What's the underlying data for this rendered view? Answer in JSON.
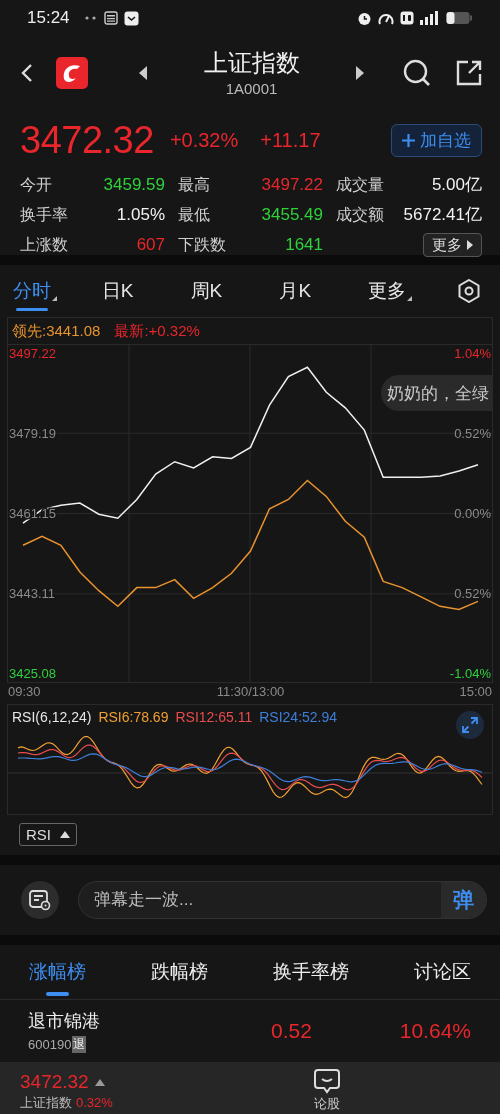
{
  "status_bar": {
    "time": "15:24"
  },
  "header": {
    "title": "上证指数",
    "code": "1A0001"
  },
  "quote": {
    "price": "3472.32",
    "change_pct": "+0.32%",
    "change": "+11.17",
    "watch_button": "加自选",
    "more_button": "更多",
    "stats": [
      {
        "label": "今开",
        "value": "3459.59",
        "color": "#2fd13a"
      },
      {
        "label": "最高",
        "value": "3497.22",
        "color": "#e8262b"
      },
      {
        "label": "成交量",
        "value": "5.00亿",
        "color": "#f2f2f2"
      },
      {
        "label": "换手率",
        "value": "1.05%",
        "color": "#f2f2f2"
      },
      {
        "label": "最低",
        "value": "3455.49",
        "color": "#2fd13a"
      },
      {
        "label": "成交额",
        "value": "5672.41亿",
        "color": "#f2f2f2"
      },
      {
        "label": "上涨数",
        "value": "607",
        "color": "#e8262b"
      },
      {
        "label": "下跌数",
        "value": "1641",
        "color": "#2fd13a"
      }
    ]
  },
  "period_tabs": [
    {
      "label": "分时",
      "selected": true,
      "has_menu": true
    },
    {
      "label": "日K",
      "selected": false,
      "has_menu": false
    },
    {
      "label": "周K",
      "selected": false,
      "has_menu": false
    },
    {
      "label": "月K",
      "selected": false,
      "has_menu": false
    },
    {
      "label": "更多",
      "selected": false,
      "has_menu": true
    }
  ],
  "intraday": {
    "legend": [
      {
        "text": "领先:3441.08",
        "color": "#e8932d"
      },
      {
        "text": "最新:+0.32%",
        "color": "#e8262b"
      }
    ],
    "right_axis": [
      {
        "text": "1.04%",
        "color": "#e8262b"
      },
      {
        "text": "0.52%",
        "color": "#8a8a8a"
      },
      {
        "text": "0.00%",
        "color": "#8a8a8a"
      },
      {
        "text": "0.52%",
        "color": "#8a8a8a"
      },
      {
        "text": "-1.04%",
        "color": "#2fd13a"
      }
    ],
    "danmaku": [
      {
        "text": "奶奶的，全绿"
      }
    ],
    "chart_data": {
      "type": "line",
      "categories": [
        "09:30",
        null,
        null,
        null,
        null,
        null,
        null,
        null,
        null,
        null,
        null,
        null,
        "11:30/13:00",
        null,
        null,
        null,
        null,
        null,
        null,
        null,
        null,
        null,
        null,
        null,
        "15:00"
      ],
      "series": [
        {
          "color": "#e8932d",
          "values": [
            3454.0,
            3456.0,
            3454.0,
            3448.0,
            3443.8,
            3440.3,
            3444.5,
            3444.5,
            3446.3,
            3442.1,
            3444.5,
            3447.7,
            3452.7,
            3462.2,
            3464.3,
            3468.6,
            3465.0,
            3459.4,
            3455.8,
            3445.9,
            3444.5,
            3442.4,
            3440.3,
            3439.6,
            3441.4
          ]
        },
        {
          "color": "#f0f0f0",
          "values": [
            3459.0,
            3462.0,
            3463.0,
            3463.5,
            3461.0,
            3460.1,
            3464.3,
            3470.0,
            3472.8,
            3471.4,
            3473.9,
            3473.5,
            3476.0,
            3485.5,
            3491.9,
            3494.0,
            3488.4,
            3484.9,
            3479.9,
            3469.3,
            3469.3,
            3469.3,
            3469.6,
            3470.7,
            3472.1
          ]
        }
      ],
      "grid": true,
      "ylim": [
        3423.28,
        3499.02
      ],
      "yticks": [
        {
          "value": 3497.22,
          "label": "3497.22"
        },
        {
          "value": 3479.19,
          "label": "3479.19"
        },
        {
          "value": 3461.15,
          "label": "3461.15"
        },
        {
          "value": 3443.11,
          "label": "3443.11"
        },
        {
          "value": 3425.08,
          "label": "3425.08"
        }
      ]
    }
  },
  "rsi": {
    "legend": [
      {
        "text": "RSI(6,12,24)",
        "color": "#e6e6e6"
      },
      {
        "text": "RSI6:78.69",
        "color": "#f0a030"
      },
      {
        "text": "RSI12:65.11",
        "color": "#e84c4c"
      },
      {
        "text": "RSI24:52.94",
        "color": "#3d7fd9"
      }
    ],
    "selector": "RSI"
  },
  "comment_bar": {
    "placeholder": "弹幕走一波...",
    "send_button": "弹"
  },
  "rank_tabs": [
    {
      "label": "涨幅榜",
      "selected": true
    },
    {
      "label": "跌幅榜",
      "selected": false
    },
    {
      "label": "换手率榜",
      "selected": false
    },
    {
      "label": "讨论区",
      "selected": false
    }
  ],
  "rank_rows": [
    {
      "name": "退市锦港",
      "code": "600190",
      "tag": "退",
      "price": "0.52",
      "change": "10.64%"
    }
  ],
  "bottom_bar": {
    "price": "3472.32",
    "name": "上证指数",
    "change": "0.32%",
    "action": "论股"
  }
}
